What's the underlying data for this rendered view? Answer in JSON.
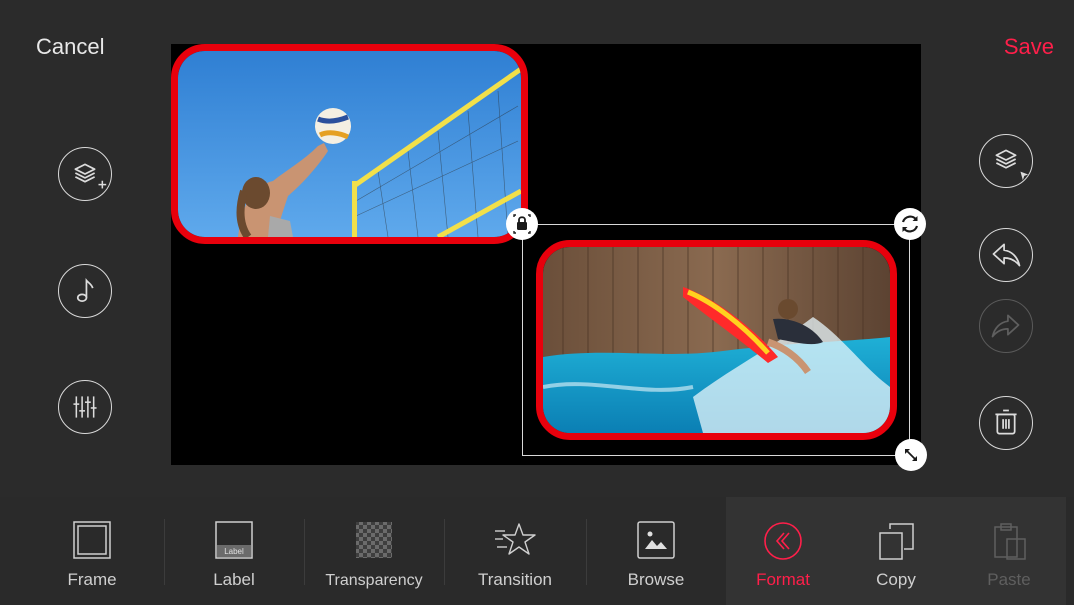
{
  "header": {
    "cancel_label": "Cancel",
    "save_label": "Save"
  },
  "left_tools": [
    {
      "name": "add-layer-icon"
    },
    {
      "name": "music-icon"
    },
    {
      "name": "mixer-icon"
    }
  ],
  "right_tools": [
    {
      "name": "select-layer-icon"
    },
    {
      "name": "undo-icon"
    },
    {
      "name": "redo-icon",
      "disabled": true
    },
    {
      "name": "trash-icon"
    }
  ],
  "canvas": {
    "photo1": {
      "subject": "beach volleyball player"
    },
    "photo2": {
      "subject": "surfer"
    }
  },
  "colors": {
    "accent": "#ff1f4a",
    "frame": "#e8000c",
    "disabled": "#5f5f5f"
  },
  "toolbar": {
    "frame_label": "Frame",
    "label_label": "Label",
    "label_icon_text": "Label",
    "transparency_label": "Transparency",
    "transition_label": "Transition",
    "browse_label": "Browse",
    "format_label": "Format",
    "copy_label": "Copy",
    "paste_label": "Paste"
  }
}
